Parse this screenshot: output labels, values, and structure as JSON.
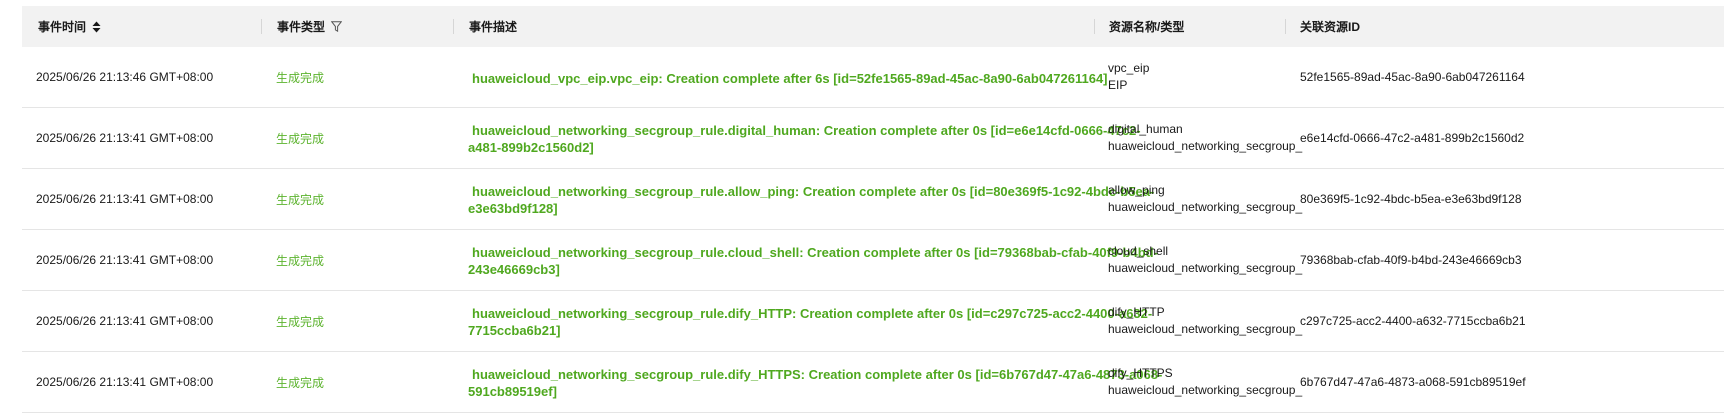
{
  "table": {
    "headers": {
      "time": "事件时间",
      "type": "事件类型",
      "desc": "事件描述",
      "resource": "资源名称/类型",
      "resource_id": "关联资源ID"
    },
    "rows": [
      {
        "time": "2025/06/26 21:13:46 GMT+08:00",
        "type": "生成完成",
        "desc": "huaweicloud_vpc_eip.vpc_eip: Creation complete after 6s [id=52fe1565-89ad-45ac-8a90-6ab047261164]",
        "res_name": "vpc_eip",
        "res_type": "EIP",
        "res_id": "52fe1565-89ad-45ac-8a90-6ab047261164"
      },
      {
        "time": "2025/06/26 21:13:41 GMT+08:00",
        "type": "生成完成",
        "desc": "huaweicloud_networking_secgroup_rule.digital_human: Creation complete after 0s [id=e6e14cfd-0666-47c2-a481-899b2c1560d2]",
        "res_name": "digital_human",
        "res_type": "huaweicloud_networking_secgroup_",
        "res_id": "e6e14cfd-0666-47c2-a481-899b2c1560d2"
      },
      {
        "time": "2025/06/26 21:13:41 GMT+08:00",
        "type": "生成完成",
        "desc": "huaweicloud_networking_secgroup_rule.allow_ping: Creation complete after 0s [id=80e369f5-1c92-4bdc-b5ea-e3e63bd9f128]",
        "res_name": "allow_ping",
        "res_type": "huaweicloud_networking_secgroup_",
        "res_id": "80e369f5-1c92-4bdc-b5ea-e3e63bd9f128"
      },
      {
        "time": "2025/06/26 21:13:41 GMT+08:00",
        "type": "生成完成",
        "desc": "huaweicloud_networking_secgroup_rule.cloud_shell: Creation complete after 0s [id=79368bab-cfab-40f9-b4bd-243e46669cb3]",
        "res_name": "cloud_shell",
        "res_type": "huaweicloud_networking_secgroup_",
        "res_id": "79368bab-cfab-40f9-b4bd-243e46669cb3"
      },
      {
        "time": "2025/06/26 21:13:41 GMT+08:00",
        "type": "生成完成",
        "desc": "huaweicloud_networking_secgroup_rule.dify_HTTP: Creation complete after 0s [id=c297c725-acc2-4400-a632-7715ccba6b21]",
        "res_name": "dify_HTTP",
        "res_type": "huaweicloud_networking_secgroup_",
        "res_id": "c297c725-acc2-4400-a632-7715ccba6b21"
      },
      {
        "time": "2025/06/26 21:13:41 GMT+08:00",
        "type": "生成完成",
        "desc": "huaweicloud_networking_secgroup_rule.dify_HTTPS: Creation complete after 0s [id=6b767d47-47a6-4873-a068-591cb89519ef]",
        "res_name": "dify_HTTPS",
        "res_type": "huaweicloud_networking_secgroup_",
        "res_id": "6b767d47-47a6-4873-a068-591cb89519ef"
      }
    ]
  },
  "colors": {
    "header_bg": "#f2f2f2",
    "success_text": "#4fa81f",
    "border": "#e5e5e5"
  },
  "icons": {
    "sort": "sort-icon",
    "filter": "filter-icon"
  }
}
